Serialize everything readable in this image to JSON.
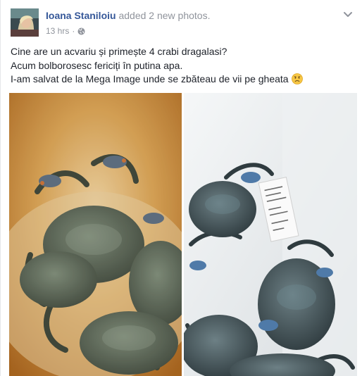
{
  "post": {
    "author": "Ioana Staniloiu",
    "action": "added 2 new photos.",
    "timestamp": "13 hrs",
    "separator": "·",
    "privacy_icon": "globe-icon",
    "menu_icon": "chevron-down-icon",
    "text_lines": [
      "Cine are un acvariu și primește 4 crabi dragalasi?",
      "Acum bolborosesc fericiți în putina apa.",
      "I-am salvat de la Mega Image unde se zbăteau de vii pe gheata"
    ],
    "emoji_icon": "worried-face-emoji-icon",
    "photos": [
      {
        "name": "crabs-in-orange-bucket-photo"
      },
      {
        "name": "crabs-on-white-tray-photo"
      }
    ]
  },
  "colors": {
    "author": "#365899",
    "meta": "#90949c",
    "text": "#1d2129",
    "bucket_orange": "#c98530",
    "tray_white": "#e9edf0"
  }
}
